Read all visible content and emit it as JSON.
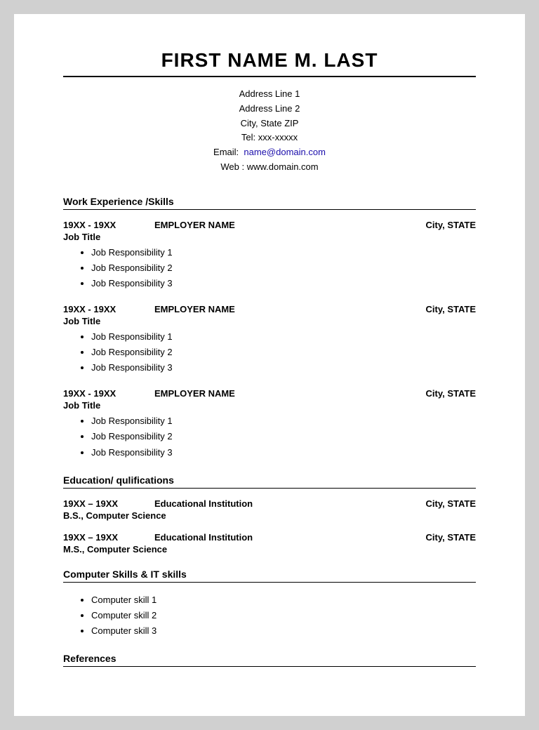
{
  "header": {
    "name": "FIRST NAME M. LAST",
    "address_line1": "Address Line 1",
    "address_line2": "Address Line 2",
    "city_state_zip": "City, State ZIP",
    "tel_label": "Tel:",
    "tel_value": "xxx-xxxxx",
    "email_label": "Email:",
    "email_text": "name@domain.com",
    "email_href": "mailto:name@domain.com",
    "web_label": "Web :",
    "web_value": "www.domain.com"
  },
  "sections": {
    "work_experience": {
      "title": "Work Experience /Skills",
      "jobs": [
        {
          "dates": "19XX - 19XX",
          "employer": "EMPLOYER NAME",
          "location": "City, STATE",
          "title": "Job Title",
          "responsibilities": [
            "Job Responsibility 1",
            "Job Responsibility 2",
            "Job Responsibility 3"
          ]
        },
        {
          "dates": "19XX - 19XX",
          "employer": "EMPLOYER NAME",
          "location": "City, STATE",
          "title": "Job Title",
          "responsibilities": [
            "Job Responsibility 1",
            "Job Responsibility 2",
            "Job Responsibility 3"
          ]
        },
        {
          "dates": "19XX - 19XX",
          "employer": "EMPLOYER NAME",
          "location": "City, STATE",
          "title": "Job Title",
          "responsibilities": [
            "Job Responsibility 1",
            "Job Responsibility 2",
            "Job Responsibility 3"
          ]
        }
      ]
    },
    "education": {
      "title": "Education/ qulifications",
      "entries": [
        {
          "dates": "19XX – 19XX",
          "institution": "Educational Institution",
          "location": "City, STATE",
          "degree": "B.S., Computer Science"
        },
        {
          "dates": "19XX – 19XX",
          "institution": "Educational Institution",
          "location": "City, STATE",
          "degree": "M.S., Computer Science"
        }
      ]
    },
    "computer_skills": {
      "title": "Computer Skills & IT skills",
      "skills": [
        "Computer skill 1",
        "Computer skill 2",
        "Computer skill 3"
      ]
    },
    "references": {
      "title": "References"
    }
  }
}
